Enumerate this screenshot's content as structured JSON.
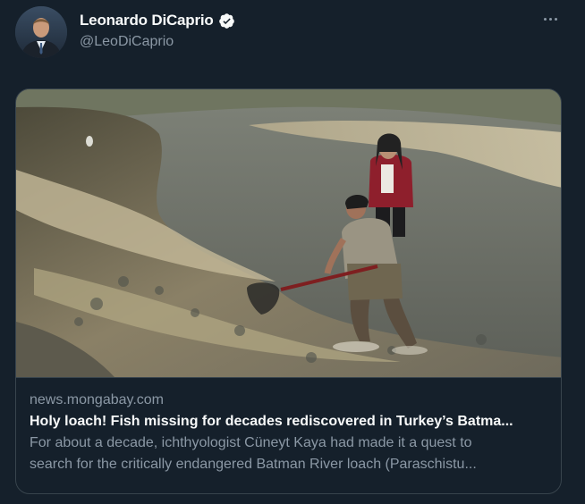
{
  "author": {
    "display_name": "Leonardo DiCaprio",
    "handle": "@LeoDiCaprio",
    "verified": true,
    "avatar_icon": "profile-photo"
  },
  "actions": {
    "more_icon": "ellipsis-icon"
  },
  "link_card": {
    "image_icon": "river-photo",
    "domain": "news.mongabay.com",
    "title": "Holy loach! Fish missing for decades rediscovered in Turkey’s Batma...",
    "description_line1": "For about a decade, ichthyologist Cüneyt Kaya had made it a quest to",
    "description_line2": "search for the critically endangered Batman River loach (Paraschistu..."
  },
  "colors": {
    "background": "#15202b",
    "border": "#38444d",
    "text_primary": "#f7f9f9",
    "text_secondary": "#8b98a5"
  }
}
